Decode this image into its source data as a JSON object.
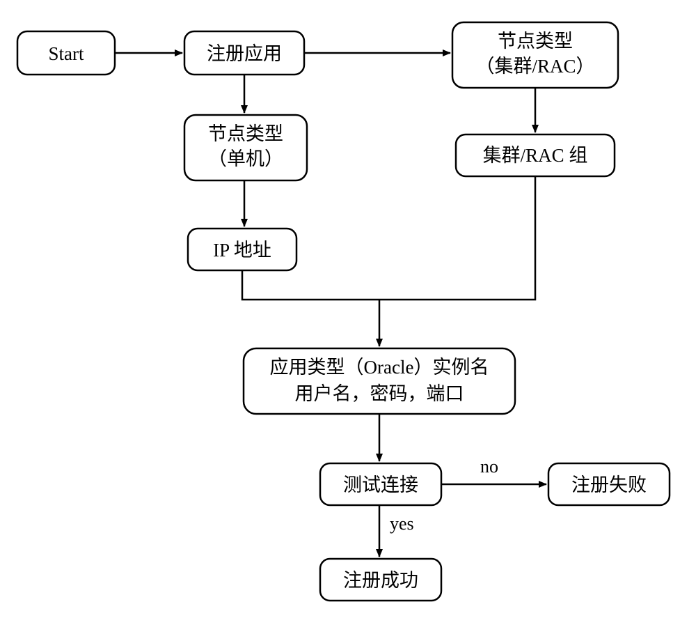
{
  "nodes": {
    "start": "Start",
    "register_app": "注册应用",
    "node_type_cluster_l1": "节点类型",
    "node_type_cluster_l2": "（集群/RAC）",
    "node_type_single_l1": "节点类型",
    "node_type_single_l2": "（单机）",
    "cluster_rac_group": "集群/RAC 组",
    "ip_address": "IP 地址",
    "app_type_l1": "应用类型（Oracle）实例名",
    "app_type_l2": "用户名，密码，端口",
    "test_conn": "测试连接",
    "reg_fail": "注册失败",
    "reg_success": "注册成功"
  },
  "edgeLabels": {
    "no": "no",
    "yes": "yes"
  }
}
